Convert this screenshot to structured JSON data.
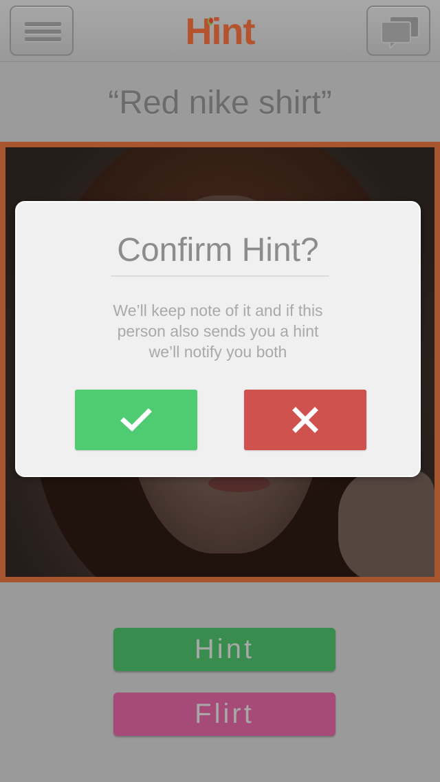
{
  "header": {
    "logo_text": "Hint",
    "menu_icon": "menu-icon",
    "chat_icon": "chat-bubbles-icon"
  },
  "hint": {
    "text": "“Red nike shirt”"
  },
  "actions": {
    "hint_label": "Hint",
    "flirt_label": "Flirt"
  },
  "modal": {
    "title": "Confirm Hint?",
    "message_lines": [
      "We’ll keep note of it and if this",
      "person also sends you a hint",
      "we’ll notify you both"
    ],
    "confirm_icon": "check-icon",
    "cancel_icon": "close-icon"
  },
  "colors": {
    "brand": "#b5532e",
    "confirm": "#4fcb72",
    "cancel": "#d0524f",
    "hint_button": "#388c4e",
    "flirt_button": "#a64a77",
    "photo_border": "#a6552e"
  }
}
